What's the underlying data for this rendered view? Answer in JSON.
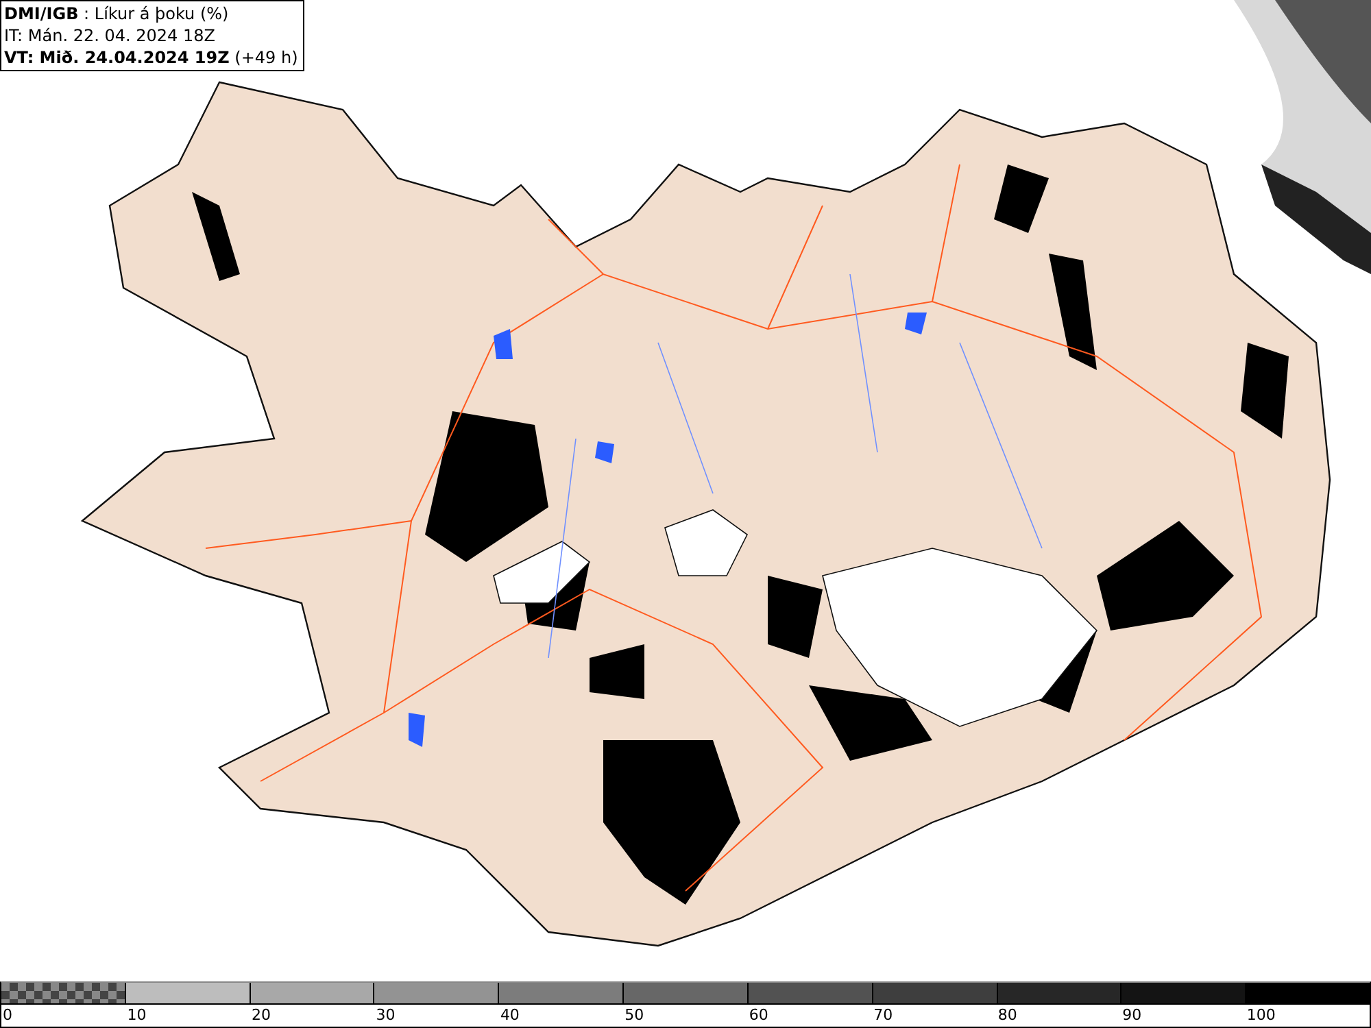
{
  "header": {
    "title": "**DMI/IGB** : Líkur á þoku (%)",
    "issue_time": "IT: Mán. 22. 04. 2024 18Z",
    "valid_time": "**VT: Mið. 24.04.2024 19Z** (+49 h)"
  },
  "legend": {
    "segments": [
      {
        "kind": "checker"
      },
      {
        "kind": "solid",
        "color": "#bdbdbd"
      },
      {
        "kind": "solid",
        "color": "#a8a8a8"
      },
      {
        "kind": "solid",
        "color": "#939393"
      },
      {
        "kind": "solid",
        "color": "#7c7c7c"
      },
      {
        "kind": "solid",
        "color": "#676767"
      },
      {
        "kind": "solid",
        "color": "#525252"
      },
      {
        "kind": "solid",
        "color": "#3e3e3e"
      },
      {
        "kind": "solid",
        "color": "#272727"
      },
      {
        "kind": "solid",
        "color": "#141414"
      },
      {
        "kind": "solid",
        "color": "#000000"
      }
    ],
    "labels": [
      "0",
      "10",
      "20",
      "30",
      "40",
      "50",
      "60",
      "70",
      "80",
      "90",
      "100"
    ]
  }
}
